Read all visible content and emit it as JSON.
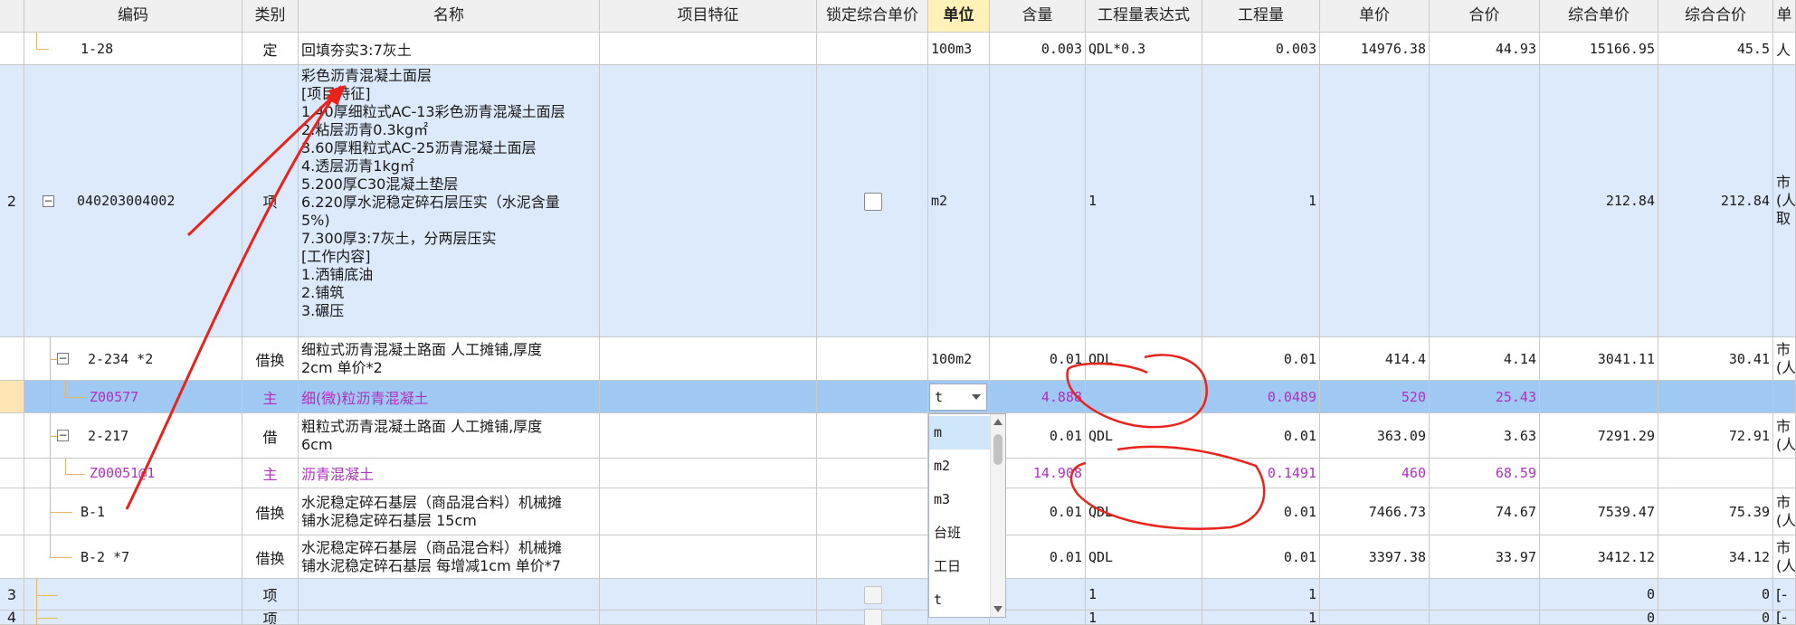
{
  "columns": [
    {
      "key": "idx",
      "label": ""
    },
    {
      "key": "code",
      "label": "编码"
    },
    {
      "key": "type",
      "label": "类别"
    },
    {
      "key": "name",
      "label": "名称"
    },
    {
      "key": "feature",
      "label": "项目特征"
    },
    {
      "key": "lock",
      "label": "锁定综合单价"
    },
    {
      "key": "unit",
      "label": "单位"
    },
    {
      "key": "content",
      "label": "含量"
    },
    {
      "key": "expr",
      "label": "工程量表达式"
    },
    {
      "key": "qty",
      "label": "工程量"
    },
    {
      "key": "price",
      "label": "单价"
    },
    {
      "key": "total",
      "label": "合价"
    },
    {
      "key": "comp_price",
      "label": "综合单价"
    },
    {
      "key": "comp_total",
      "label": "综合合价"
    },
    {
      "key": "extra",
      "label": "单"
    }
  ],
  "rows": [
    {
      "idx": "",
      "code": "1-28",
      "type": "定",
      "name": "回填夯实3:7灰土",
      "unit": "100m3",
      "content": "0.003",
      "expr": "QDL*0.3",
      "qty": "0.003",
      "price": "14976.38",
      "total": "44.93",
      "comp_price": "15166.95",
      "comp_total": "45.5",
      "extra": "人"
    },
    {
      "idx": "2",
      "code": "040203004002",
      "type": "项",
      "name_lines": [
        "彩色沥青混凝土面层",
        "[项目特征]",
        "1.40厚细粒式AC-13彩色沥青混凝土面层",
        "2.粘层沥青0.3kg㎡",
        "3.60厚粗粒式AC-25沥青混凝土面层",
        "4.透层沥青1kg㎡",
        "5.200厚C30混凝土垫层",
        "6.220厚水泥稳定碎石层压实（水泥含量",
        "5%)",
        "7.300厚3:7灰土，分两层压实",
        "[工作内容]",
        "1.洒铺底油",
        "2.铺筑",
        "3.碾压"
      ],
      "unit": "m2",
      "content": "",
      "expr": "1",
      "qty": "1",
      "price": "",
      "total": "",
      "comp_price": "212.84",
      "comp_total": "212.84",
      "extra_lines": [
        "市",
        "(人",
        "取"
      ]
    },
    {
      "idx": "",
      "code": "2-234 *2",
      "type": "借换",
      "name_lines": [
        "细粒式沥青混凝土路面 人工摊铺,厚度",
        "2cm  单价*2"
      ],
      "unit": "100m2",
      "content": "0.01",
      "expr": "QDL",
      "qty": "0.01",
      "price": "414.4",
      "total": "4.14",
      "comp_price": "3041.11",
      "comp_total": "30.41",
      "extra_lines": [
        "市",
        "(人"
      ]
    },
    {
      "idx": "",
      "code": "Z00577",
      "type": "主",
      "name": "细(微)粒沥青混凝土",
      "unit": "t",
      "content": "4.888",
      "expr": "",
      "qty": "0.0489",
      "price": "520",
      "total": "25.43",
      "comp_price": "",
      "comp_total": "",
      "extra": ""
    },
    {
      "idx": "",
      "code": "2-217",
      "type": "借",
      "name_lines": [
        "粗粒式沥青混凝土路面 人工摊铺,厚度",
        "6cm"
      ],
      "unit": "",
      "content": "0.01",
      "expr": "QDL",
      "qty": "0.01",
      "price": "363.09",
      "total": "3.63",
      "comp_price": "7291.29",
      "comp_total": "72.91",
      "extra_lines": [
        "市",
        "(人"
      ]
    },
    {
      "idx": "",
      "code": "Z00051@1",
      "type": "主",
      "name": "沥青混凝土",
      "unit": "",
      "content": "14.908",
      "expr": "",
      "qty": "0.1491",
      "price": "460",
      "total": "68.59",
      "comp_price": "",
      "comp_total": "",
      "extra": ""
    },
    {
      "idx": "",
      "code": "B-1",
      "type": "借换",
      "name_lines": [
        "水泥稳定碎石基层（商品混合料）机械摊",
        "铺水泥稳定碎石基层 15cm"
      ],
      "unit": "",
      "content": "0.01",
      "expr": "QDL",
      "qty": "0.01",
      "price": "7466.73",
      "total": "74.67",
      "comp_price": "7539.47",
      "comp_total": "75.39",
      "extra_lines": [
        "市",
        "(人"
      ]
    },
    {
      "idx": "",
      "code": "B-2 *7",
      "type": "借换",
      "name_lines": [
        "水泥稳定碎石基层（商品混合料）机械摊",
        "铺水泥稳定碎石基层 每增减1cm  单价*7"
      ],
      "unit": "",
      "content": "0.01",
      "expr": "QDL",
      "qty": "0.01",
      "price": "3397.38",
      "total": "33.97",
      "comp_price": "3412.12",
      "comp_total": "34.12",
      "extra_lines": [
        "市",
        "(人"
      ]
    },
    {
      "idx": "3",
      "code": "",
      "type": "项",
      "name": "",
      "unit": "",
      "content": "",
      "expr": "1",
      "qty": "1",
      "price": "",
      "total": "",
      "comp_price": "0",
      "comp_total": "0",
      "extra": "[-"
    },
    {
      "idx": "4",
      "code": "",
      "type": "项",
      "name": "",
      "unit": "",
      "content": "",
      "expr": "1",
      "qty": "1",
      "price": "",
      "total": "",
      "comp_price": "0",
      "comp_total": "0",
      "extra": "[-"
    }
  ],
  "dropdown": {
    "current": "t",
    "options": [
      "m",
      "m2",
      "m3",
      "台班",
      "工日",
      "t"
    ],
    "highlighted": "m"
  },
  "colors": {
    "header_bg": "#f0f0f0",
    "selected_header_bg": "#fff2b8",
    "qd_row_bg": "#dceafb",
    "selected_row_bg": "#9fc9f3",
    "main_material_text": "#b030c0",
    "annotation_red": "#e8231c",
    "tree_line": "#e4b56b"
  },
  "icons": {
    "expand": "minus-toggle-icon",
    "checkbox": "checkbox-icon",
    "dropdown": "chevron-down-icon"
  }
}
